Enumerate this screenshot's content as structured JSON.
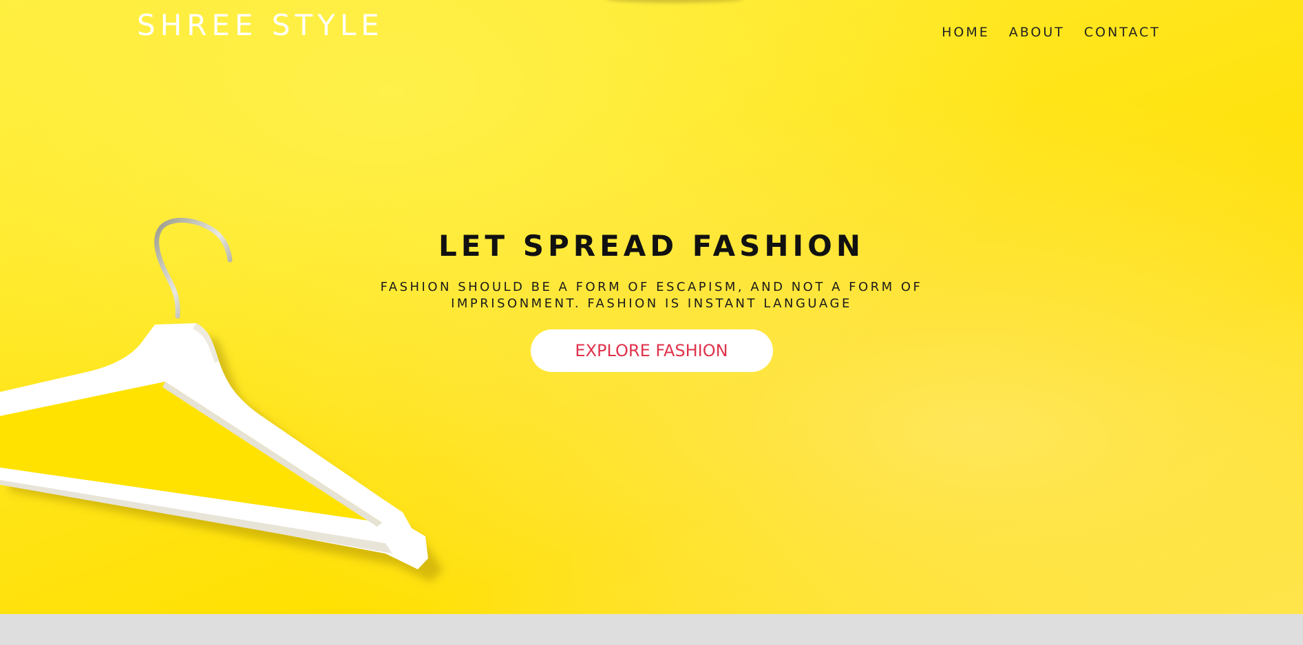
{
  "header": {
    "brand": "SHREE STYLE",
    "nav": [
      {
        "label": "HOME"
      },
      {
        "label": "ABOUT"
      },
      {
        "label": "CONTACT"
      }
    ]
  },
  "hero": {
    "headline": "LET SPREAD FASHION",
    "tagline": "FASHION SHOULD BE A FORM OF ESCAPISM, AND NOT A FORM OF IMPRISONMENT. FASHION IS INSTANT LANGUAGE",
    "cta_label": "EXPLORE FASHION",
    "image": "clothes-hanger-illustration"
  },
  "colors": {
    "background": "#ffe417",
    "brand_text": "#ffffff",
    "nav_text": "#222222",
    "headline_text": "#111111",
    "cta_background": "#ffffff",
    "cta_text": "#e0324b",
    "footer_band": "#dedede"
  }
}
